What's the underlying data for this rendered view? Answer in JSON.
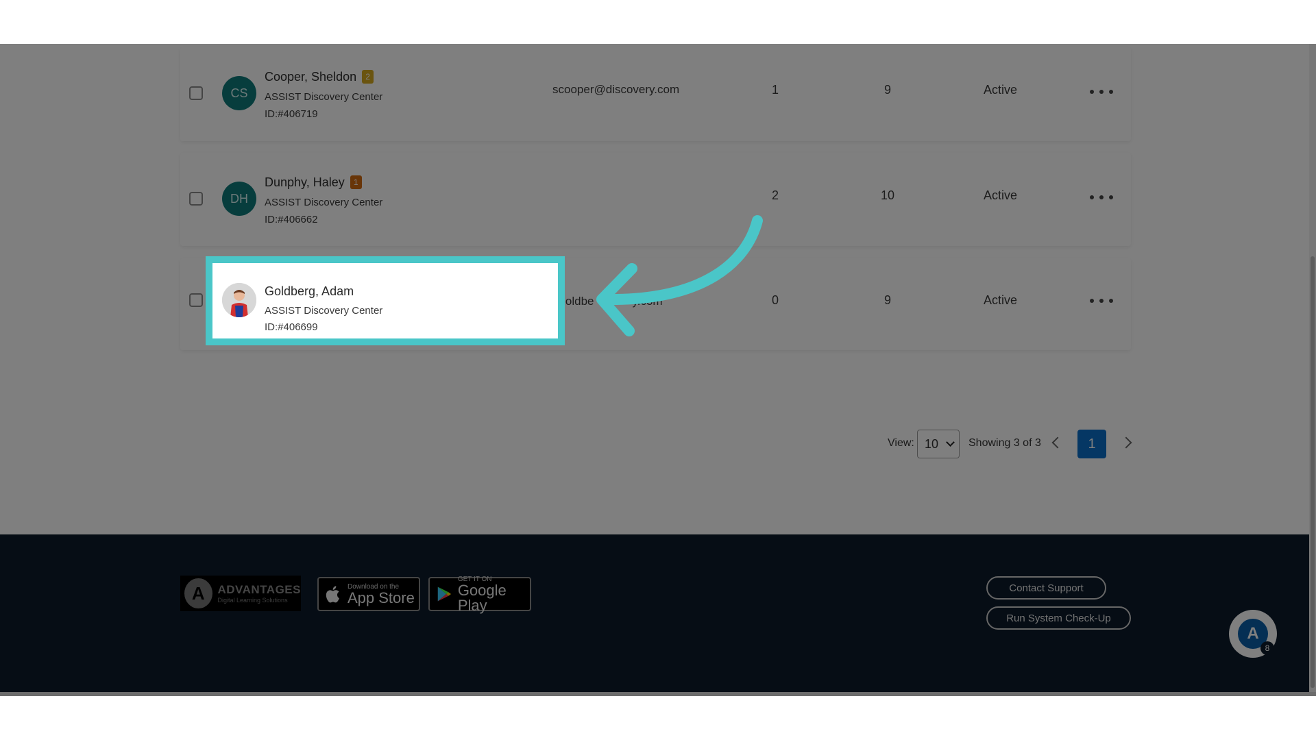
{
  "rows": [
    {
      "initials": "CS",
      "name": "Cooper, Sheldon",
      "badge": "2",
      "badge_color": "#d4a81e",
      "org": "ASSIST Discovery Center",
      "id": "ID:#406719",
      "email": "scooper@discovery.com",
      "col1": "1",
      "col2": "9",
      "status": "Active"
    },
    {
      "initials": "DH",
      "name": "Dunphy, Haley",
      "badge": "1",
      "badge_color": "#d06a10",
      "org": "ASSIST Discovery Center",
      "id": "ID:#406662",
      "email": "",
      "col1": "2",
      "col2": "10",
      "status": "Active"
    },
    {
      "initials": "",
      "name": "Goldberg, Adam",
      "org": "ASSIST Discovery Center",
      "id": "ID:#406699",
      "email": "agoldbe",
      "email_tail": "y.com",
      "col1": "0",
      "col2": "9",
      "status": "Active"
    }
  ],
  "pagination": {
    "view_label": "View:",
    "view_value": "10",
    "showing": "Showing 3 of 3",
    "current_page": "1"
  },
  "footer": {
    "brand_name": "ADVANTAGES",
    "brand_tagline": "Digital Learning Solutions",
    "app_store_small": "Download on the",
    "app_store_big": "App Store",
    "google_play_small": "GET IT ON",
    "google_play_big": "Google Play",
    "contact_support": "Contact Support",
    "run_checkup": "Run System Check-Up",
    "chat_count": "8"
  },
  "colors": {
    "accent_highlight": "#4ac6c8",
    "page_button": "#0a6ec9",
    "avatar_bg": "#0e7a7a",
    "footer_bg": "#0c1a2a"
  }
}
